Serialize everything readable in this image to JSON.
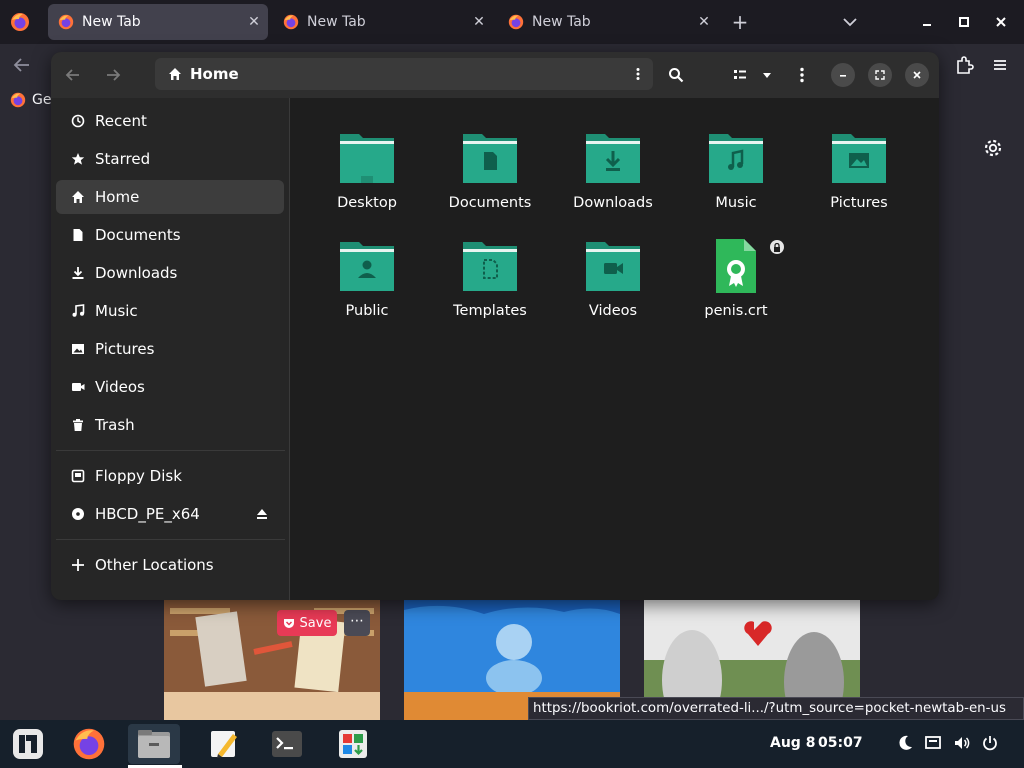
{
  "browser": {
    "tabs": [
      {
        "label": "New Tab",
        "close": "✕"
      },
      {
        "label": "New Tab",
        "close": "✕"
      },
      {
        "label": "New Tab",
        "close": "✕"
      }
    ],
    "new_tab_symbol": "+",
    "bookmark_label": "Ge",
    "save_label": "Save",
    "card_more": "⋯",
    "status_url": "https://bookriot.com/overrated-li.../?utm_source=pocket-newtab-en-us"
  },
  "file_manager": {
    "path": "Home",
    "sidebar": {
      "places": [
        {
          "label": "Recent",
          "icon": "clock-icon"
        },
        {
          "label": "Starred",
          "icon": "star-icon"
        },
        {
          "label": "Home",
          "icon": "home-icon",
          "active": true
        },
        {
          "label": "Documents",
          "icon": "document-icon"
        },
        {
          "label": "Downloads",
          "icon": "download-icon"
        },
        {
          "label": "Music",
          "icon": "music-icon"
        },
        {
          "label": "Pictures",
          "icon": "picture-icon"
        },
        {
          "label": "Videos",
          "icon": "video-icon"
        },
        {
          "label": "Trash",
          "icon": "trash-icon"
        }
      ],
      "devices": [
        {
          "label": "Floppy Disk",
          "icon": "drive-icon"
        },
        {
          "label": "HBCD_PE_x64",
          "icon": "disc-icon"
        }
      ],
      "other": {
        "label": "Other Locations",
        "icon": "plus-icon"
      }
    },
    "items": [
      {
        "name": "Desktop",
        "type": "folder",
        "glyph": "desktop"
      },
      {
        "name": "Documents",
        "type": "folder",
        "glyph": "document"
      },
      {
        "name": "Downloads",
        "type": "folder",
        "glyph": "download"
      },
      {
        "name": "Music",
        "type": "folder",
        "glyph": "music"
      },
      {
        "name": "Pictures",
        "type": "folder",
        "glyph": "picture"
      },
      {
        "name": "Public",
        "type": "folder",
        "glyph": "person"
      },
      {
        "name": "Templates",
        "type": "folder",
        "glyph": "template"
      },
      {
        "name": "Videos",
        "type": "folder",
        "glyph": "video"
      },
      {
        "name": "penis.crt",
        "type": "certificate",
        "locked": true
      }
    ]
  },
  "taskbar": {
    "date": "Aug 8",
    "time": "05:07"
  },
  "colors": {
    "folder": "#26a98a",
    "folder_tab": "#1f8f74",
    "folder_stripe": "#e8f5f1",
    "accent_red": "#e83a56",
    "fm_bg": "#1e1e1e",
    "sidebar_bg": "#262626",
    "header_bg": "#2e2e2e",
    "taskbar_bg": "#16202b"
  }
}
